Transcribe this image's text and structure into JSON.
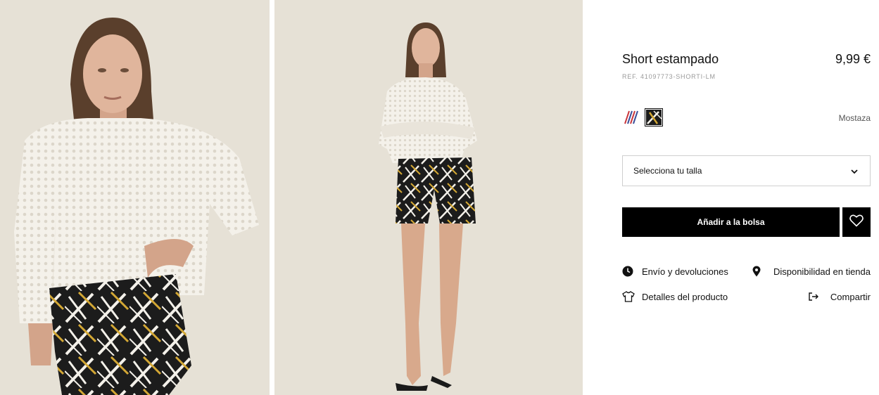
{
  "product": {
    "title": "Short estampado",
    "price": "9,99 €",
    "ref": "REF. 41097773-SHORTI-LM",
    "selected_color": "Mostaza"
  },
  "colors": [
    {
      "name": "stripes-swatch",
      "hex": "#c9363c"
    },
    {
      "name": "mustard-palm-swatch",
      "hex": "#d4a834"
    }
  ],
  "size_selector": {
    "label": "Selecciona tu talla"
  },
  "actions": {
    "add_to_bag": "Añadir a la bolsa"
  },
  "links": {
    "shipping": "Envío y devoluciones",
    "store": "Disponibilidad en tienda",
    "details": "Detalles del producto",
    "share": "Compartir"
  }
}
